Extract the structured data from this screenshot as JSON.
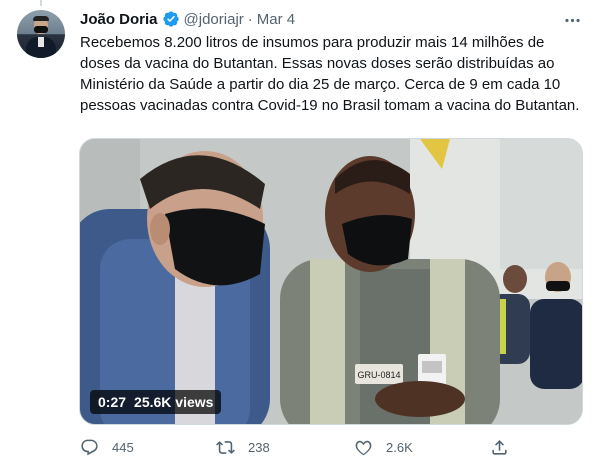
{
  "tweet": {
    "author_name": "João Doria",
    "handle": "@jdoriajr",
    "separator": "·",
    "timestamp": "Mar 4",
    "text": "Recebemos 8.200 litros de insumos para produzir mais 14 milhões de doses da vacina do Butantan. Essas novas doses serão distribuídas ao Ministério da Saúde a partir do dia 25 de março. Cerca de 9 em cada 10 pessoas vacinadas contra Covid-19 no Brasil tomam a vacina do Butantan.",
    "video": {
      "duration": "0:27",
      "views": "25.6K views",
      "badge_text_on_vest": "GRU-0814"
    },
    "actions": {
      "reply_count": "445",
      "retweet_count": "238",
      "like_count": "2.6K"
    }
  },
  "icons": {
    "verified": "verified-badge-icon",
    "more": "more-dots-icon",
    "reply": "reply-icon",
    "retweet": "retweet-icon",
    "like": "heart-icon",
    "share": "share-icon"
  },
  "colors": {
    "text": "#0f1419",
    "secondary": "#536471",
    "verified": "#1d9bf0",
    "border": "#cfd9de"
  }
}
